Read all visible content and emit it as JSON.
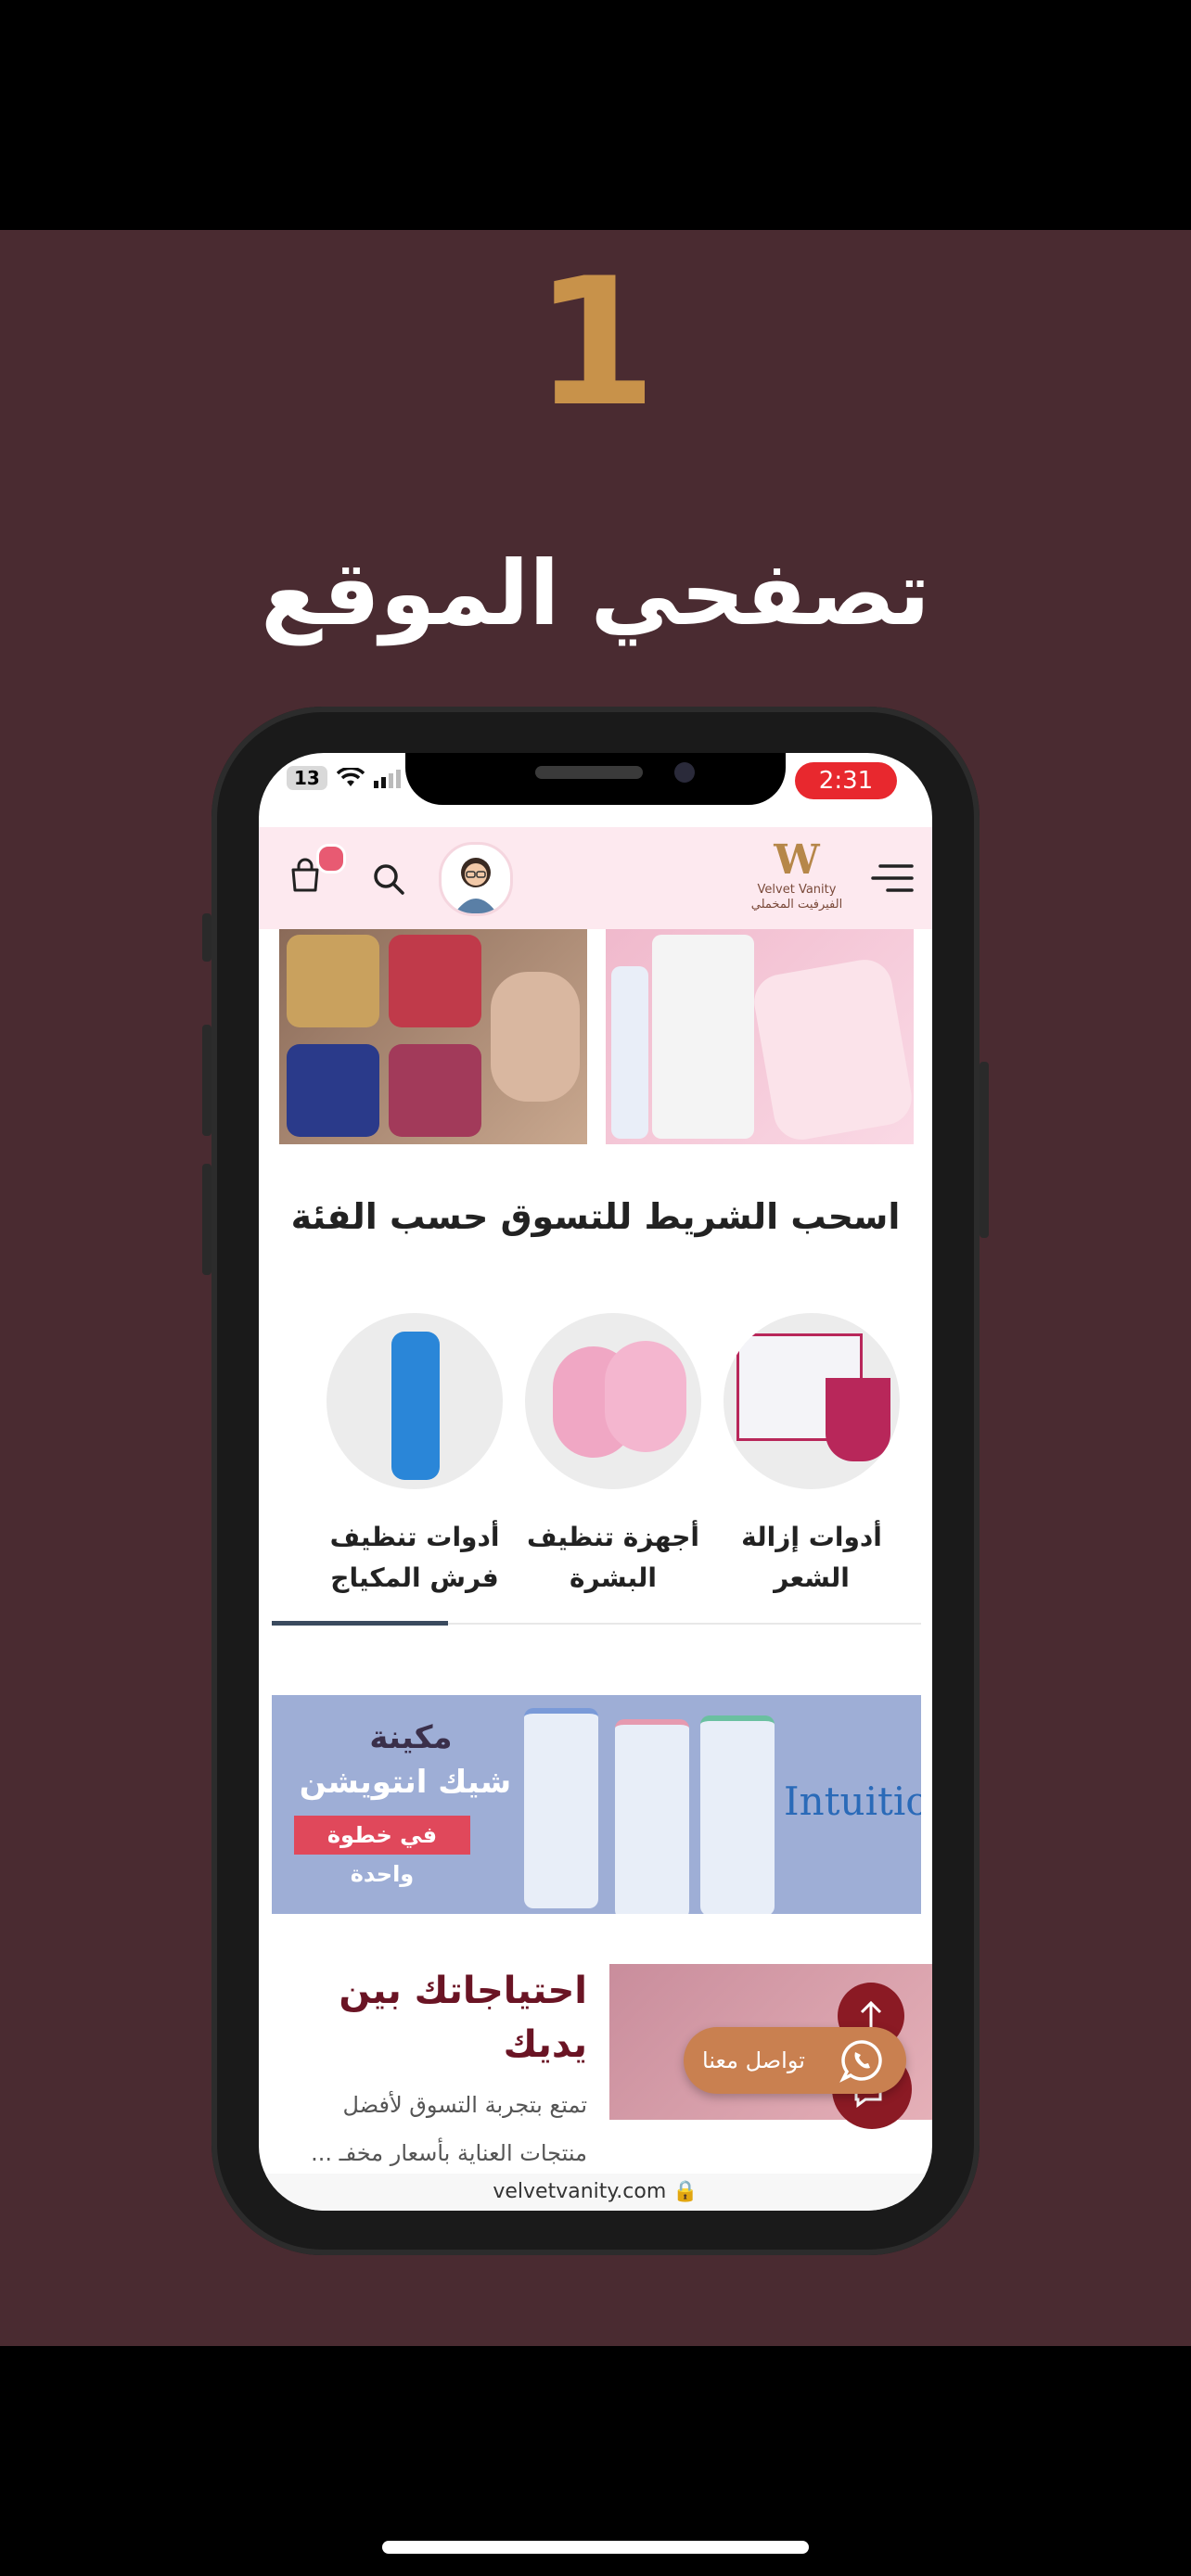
{
  "slide": {
    "step_number": "1",
    "title": "تصفحي الموقع"
  },
  "status_bar": {
    "battery": "13",
    "time": "2:31"
  },
  "header": {
    "logo_text": "Velvet Vanity",
    "logo_subtext": "الفيرفيت المخملي"
  },
  "sections": {
    "drag_title": "اسحب الشريط للتسوق حسب الفئة"
  },
  "categories": [
    {
      "label": "أدوات إزالة الشعر"
    },
    {
      "label": "أجهزة تنظيف البشرة"
    },
    {
      "label": "أدوات تنظيف فرش المكياج"
    }
  ],
  "promo": {
    "line1": "مكينة",
    "line2": "شيك انتويشن",
    "tag": "في خطوة واحدة",
    "brand": "Intuition"
  },
  "needs": {
    "title": "احتياجاتك بين يديك",
    "description": "تمتع بتجربة التسوق لأفضل منتجات العناية بأسعار مخفـ ..."
  },
  "floating": {
    "whatsapp_label": "تواصل معنا"
  },
  "browser": {
    "url": "velvetvanity.com 🔒"
  },
  "colors": {
    "background": "#4a2b31",
    "accent_gold": "#c8924a",
    "header_pink": "#fde9ef",
    "brand_red": "#8b1a24",
    "whatsapp_pill": "#c98050",
    "time_pill": "#e8282e"
  }
}
